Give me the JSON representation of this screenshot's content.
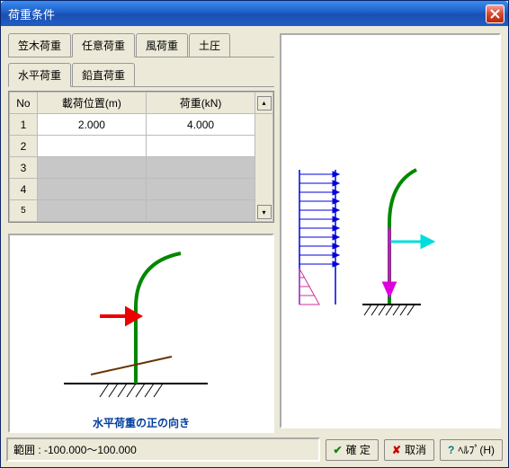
{
  "window": {
    "title": "荷重条件"
  },
  "main_tabs": [
    "笠木荷重",
    "任意荷重",
    "風荷重",
    "土圧"
  ],
  "main_tab_active": 1,
  "sub_tabs": [
    "水平荷重",
    "鉛直荷重"
  ],
  "sub_tab_active": 0,
  "table": {
    "headers": {
      "no": "No",
      "pos": "載荷位置(m)",
      "load": "荷重(kN)"
    },
    "rows": [
      {
        "no": "1",
        "pos": "2.000",
        "load": "4.000"
      },
      {
        "no": "2",
        "pos": "",
        "load": ""
      },
      {
        "no": "3",
        "pos": "",
        "load": ""
      },
      {
        "no": "4",
        "pos": "",
        "load": ""
      },
      {
        "no": "5",
        "pos": "",
        "load": ""
      }
    ]
  },
  "left_diagram": {
    "caption": "水平荷重の正の向き"
  },
  "footer": {
    "range": "範囲 : -100.000～100.000"
  },
  "buttons": {
    "confirm": "確 定",
    "cancel": "取消",
    "help": "ﾍﾙﾌﾟ(H)"
  }
}
